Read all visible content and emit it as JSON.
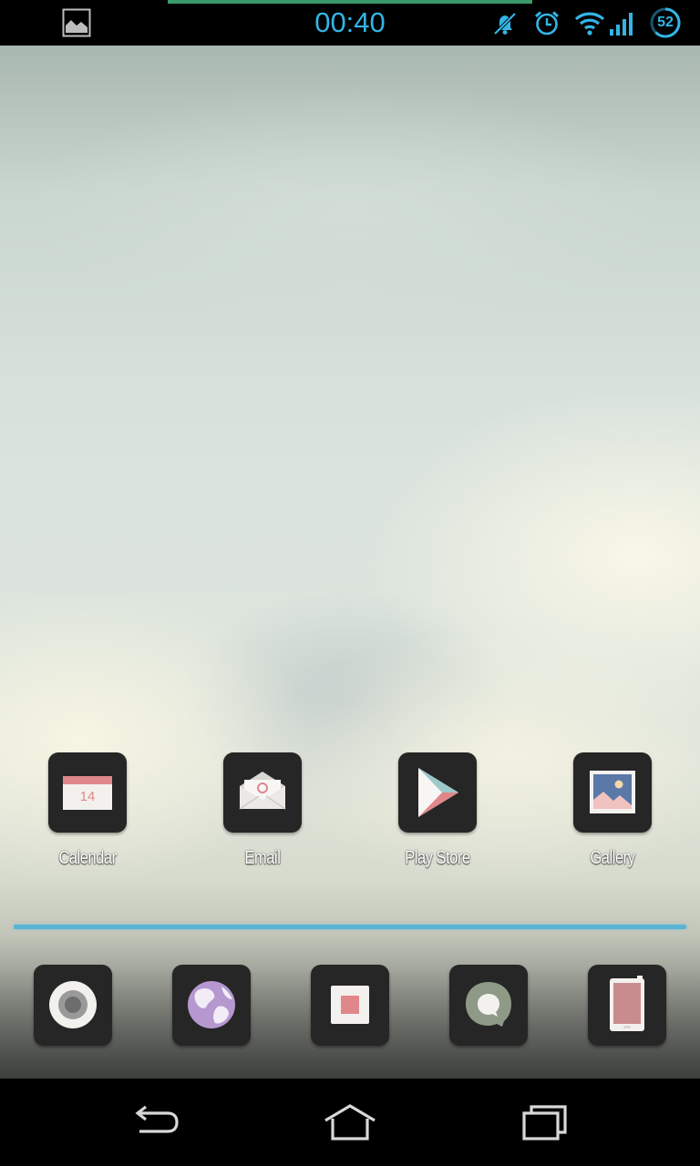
{
  "status_bar": {
    "time": "00:40",
    "battery_level": "52",
    "icons": [
      "gallery-notification-icon",
      "notifications-muted-icon",
      "alarm-icon",
      "wifi-icon",
      "signal-icon",
      "battery-icon"
    ],
    "accent_color": "#33b5e5"
  },
  "home": {
    "apps": [
      {
        "label": "Calendar",
        "icon": "calendar-icon",
        "date": "14"
      },
      {
        "label": "Email",
        "icon": "email-icon"
      },
      {
        "label": "Play Store",
        "icon": "play-store-icon"
      },
      {
        "label": "Gallery",
        "icon": "gallery-icon"
      }
    ]
  },
  "dock": {
    "divider_color": "#5ab4d6",
    "items": [
      {
        "icon": "camera-icon"
      },
      {
        "icon": "browser-icon"
      },
      {
        "icon": "app-drawer-icon"
      },
      {
        "icon": "messaging-icon"
      },
      {
        "icon": "phone-icon"
      }
    ]
  },
  "nav_bar": {
    "buttons": [
      "back-icon",
      "home-icon",
      "recent-apps-icon"
    ]
  }
}
